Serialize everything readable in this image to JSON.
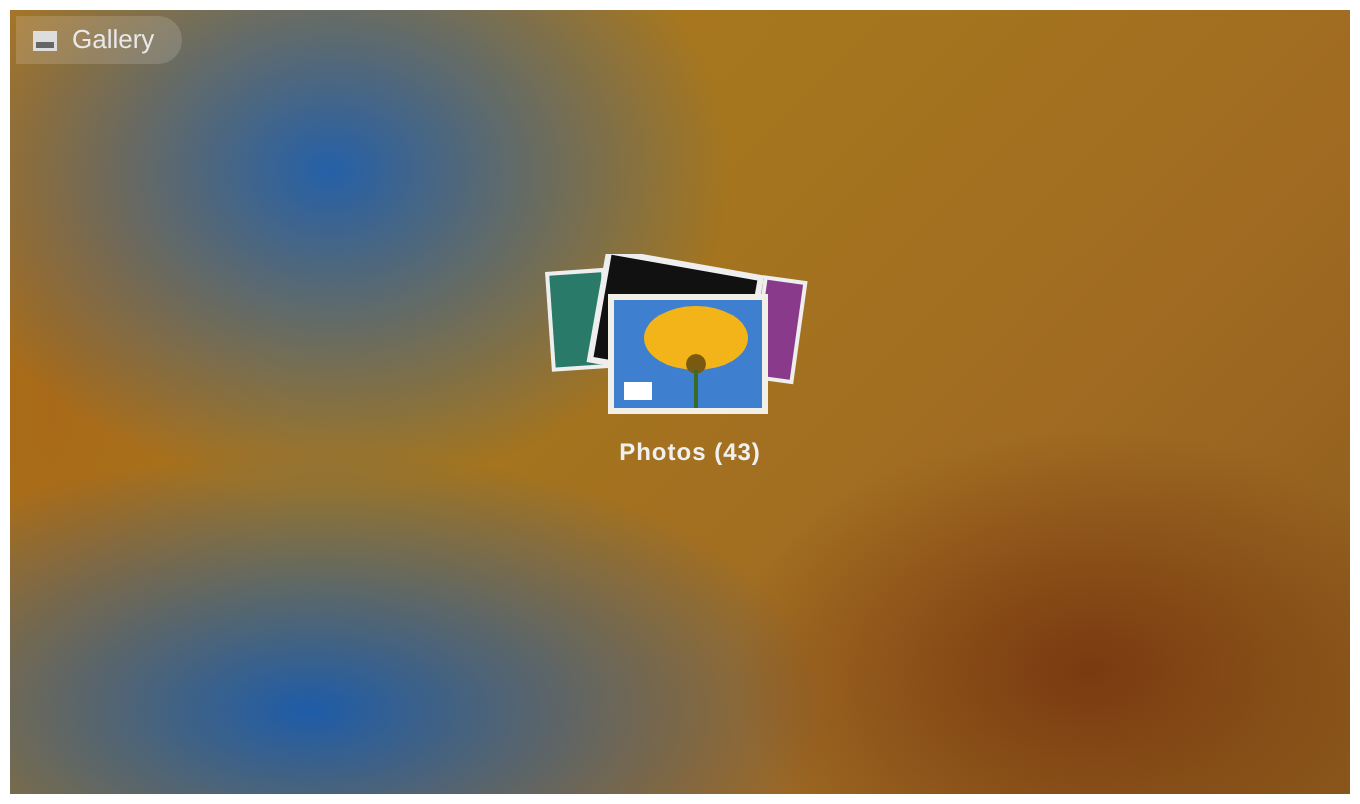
{
  "app_bar": {
    "title": "Gallery"
  },
  "albums": [
    {
      "label": "Photos (43)"
    }
  ]
}
